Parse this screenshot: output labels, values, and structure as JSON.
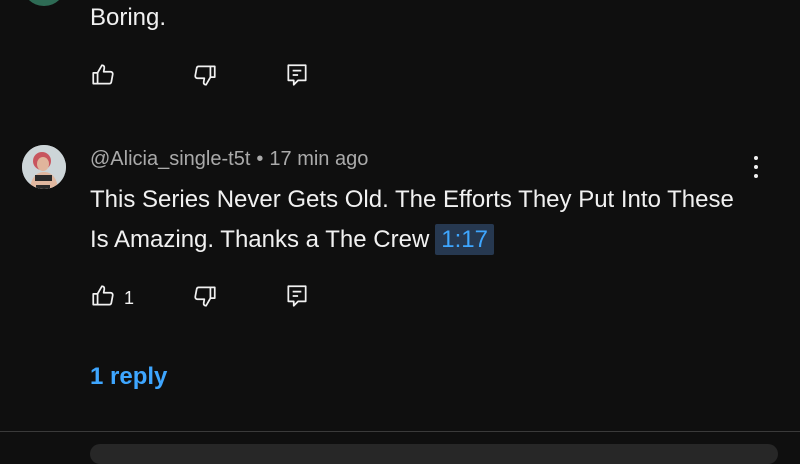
{
  "previous_comment": {
    "text": "Boring."
  },
  "comment": {
    "author": "@Alicia_single-t5t",
    "separator": "•",
    "time": "17 min ago",
    "text": "This Series Never Gets Old. The Efforts They Put Into These Is Amazing. Thanks a The Crew",
    "timestamp_link": "1:17",
    "like_count": "1",
    "replies_label": "1 reply"
  },
  "icons": {
    "like": "thumbs-up-icon",
    "dislike": "thumbs-down-icon",
    "reply": "reply-icon",
    "menu": "more-vertical-icon"
  },
  "colors": {
    "background": "#0f0f0f",
    "text": "#f1f1f1",
    "meta": "#aaaaaa",
    "link": "#3ea6ff",
    "timestamp_bg": "#263850"
  }
}
